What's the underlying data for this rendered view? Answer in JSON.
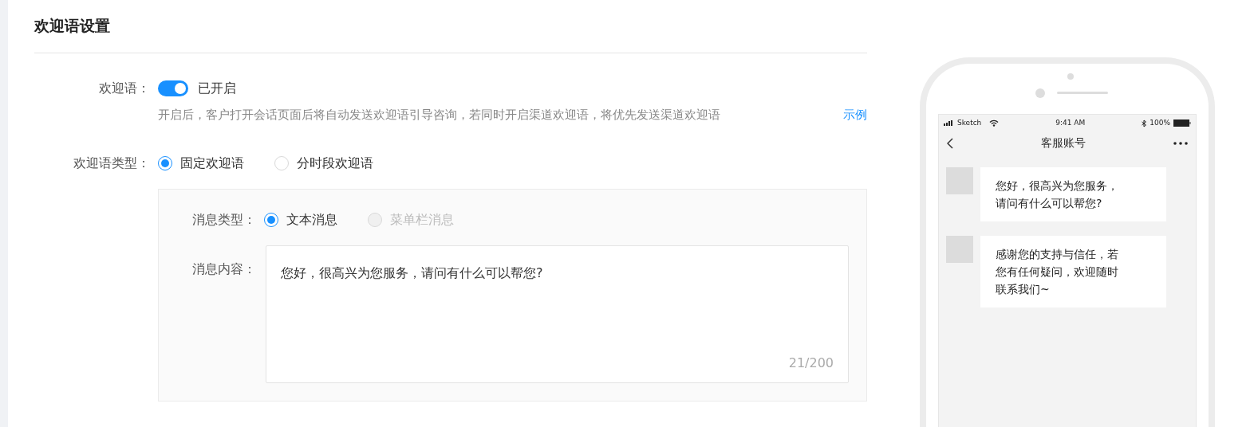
{
  "section_title": "欢迎语设置",
  "welcome": {
    "label": "欢迎语：",
    "on": true,
    "status": "已开启",
    "hint": "开启后，客户打开会话页面后将自动发送欢迎语引导咨询，若同时开启渠道欢迎语，将优先发送渠道欢迎语",
    "example_link": "示例"
  },
  "welcome_type": {
    "label": "欢迎语类型：",
    "options": [
      {
        "label": "固定欢迎语",
        "selected": true
      },
      {
        "label": "分时段欢迎语",
        "selected": false
      }
    ]
  },
  "message_type": {
    "label": "消息类型：",
    "options": [
      {
        "label": "文本消息",
        "selected": true,
        "disabled": false
      },
      {
        "label": "菜单栏消息",
        "selected": false,
        "disabled": true
      }
    ]
  },
  "message_content": {
    "label": "消息内容：",
    "value": "您好，很高兴为您服务，请问有什么可以帮您?",
    "counter": "21/200"
  },
  "phone": {
    "status_bar": {
      "carrier": "Sketch",
      "time": "9:41 AM",
      "battery": "100%"
    },
    "title": "客服账号",
    "messages": [
      {
        "text": "您好，很高兴为您服务，请问有什么可以帮您?"
      },
      {
        "text": "感谢您的支持与信任，若您有任何疑问，欢迎随时联系我们~"
      }
    ]
  }
}
